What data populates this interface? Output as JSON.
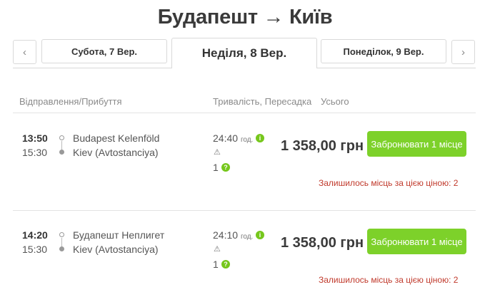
{
  "header": {
    "title": "Будапешт → Київ"
  },
  "date_nav": {
    "prev_glyph": "‹",
    "next_glyph": "›",
    "prev_day": "Субота, 7 Вер.",
    "current_day": "Неділя, 8 Вер.",
    "next_day": "Понеділок, 9 Вер."
  },
  "columns": {
    "departure_arrival": "Відправлення/Прибуття",
    "duration_transfer": "Тривалість, Пересадка",
    "total": "Усього"
  },
  "trips": [
    {
      "departure_time": "13:50",
      "arrival_time": "15:30",
      "from_station": "Budapest Kelenföld",
      "to_station": "Kiev (Avtostanciya)",
      "duration": "24:40",
      "duration_unit": "год.",
      "transfers": "1",
      "price": "1 358,00 грн",
      "book_label": "Забронювати 1 місце",
      "seats_note": "Залишилось місць за цією ціною: 2"
    },
    {
      "departure_time": "14:20",
      "arrival_time": "15:30",
      "from_station": "Будапешт Неплигет",
      "to_station": "Kiev (Avtostanciya)",
      "duration": "24:10",
      "duration_unit": "год.",
      "transfers": "1",
      "price": "1 358,00 грн",
      "book_label": "Забронювати 1 місце",
      "seats_note": "Залишилось місць за цією ціною: 2"
    }
  ],
  "icons": {
    "info": "info-icon",
    "warning": "warning-icon",
    "help": "help-icon"
  },
  "colors": {
    "accent_green": "#7dd12a",
    "warning_red": "#c0392b"
  }
}
